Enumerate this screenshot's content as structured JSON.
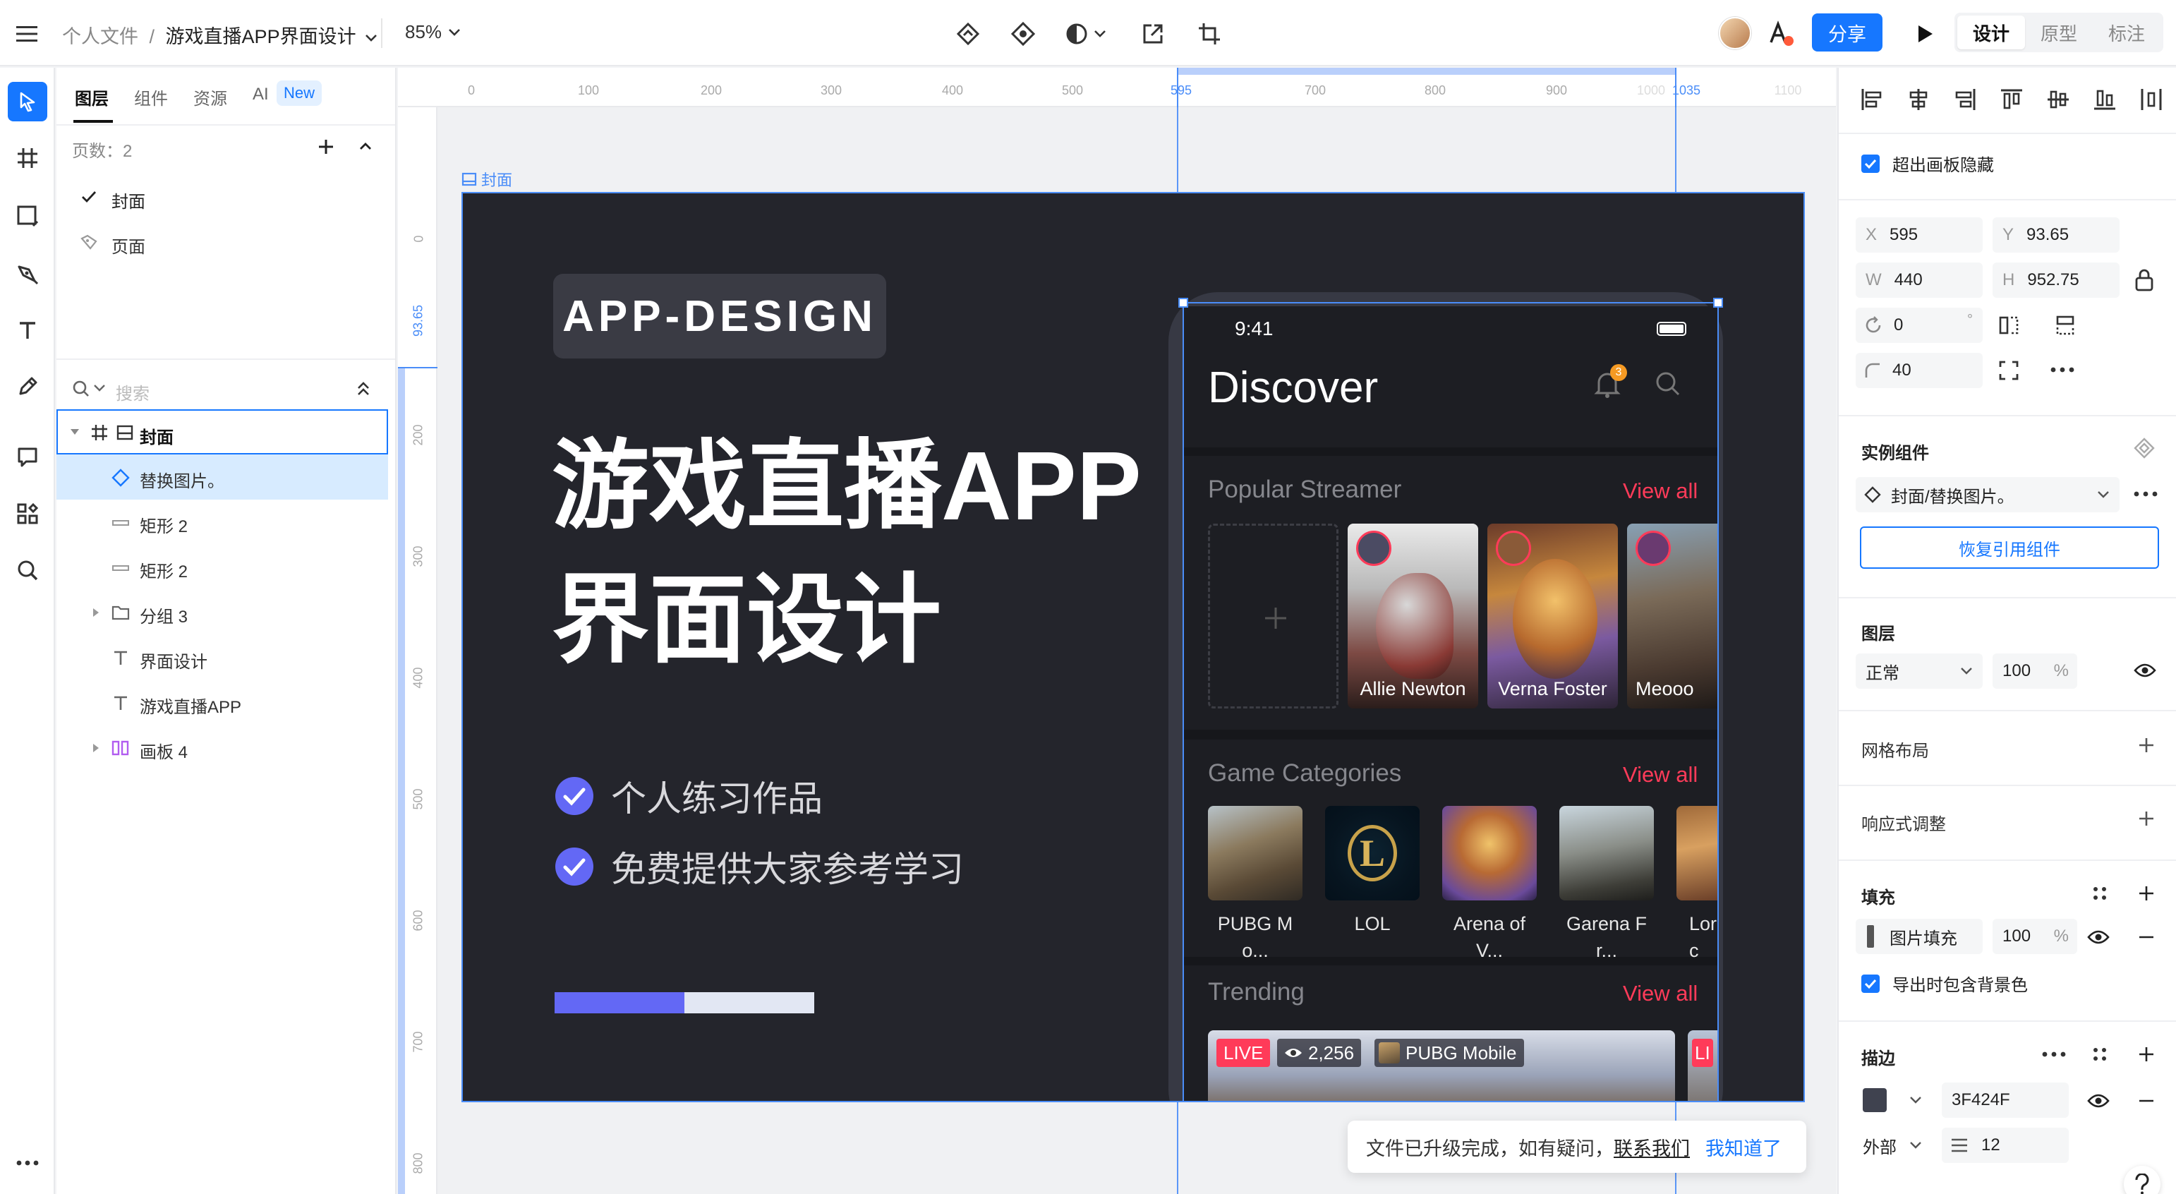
{
  "topbar": {
    "breadcrumb_root": "个人文件",
    "breadcrumb_sep": "/",
    "file_name": "游戏直播APP界面设计",
    "zoom": "85%",
    "share_label": "分享",
    "modes": [
      "设计",
      "原型",
      "标注"
    ]
  },
  "layer_panel": {
    "tabs": [
      "图层",
      "组件",
      "资源",
      "AI"
    ],
    "ai_badge": "New",
    "pages_label": "页数：2",
    "pages": [
      "封面",
      "页面"
    ],
    "search_placeholder": "搜索",
    "layers": [
      {
        "label": "封面",
        "type": "frame"
      },
      {
        "label": "替换图片。",
        "type": "component"
      },
      {
        "label": "矩形 2",
        "type": "rect"
      },
      {
        "label": "矩形 2",
        "type": "rect"
      },
      {
        "label": "分组 3",
        "type": "group"
      },
      {
        "label": "界面设计",
        "type": "text"
      },
      {
        "label": "游戏直播APP",
        "type": "text"
      },
      {
        "label": "画板 4",
        "type": "board"
      }
    ]
  },
  "ruler": {
    "top": [
      "0",
      "100",
      "200",
      "300",
      "400",
      "500",
      "595",
      "700",
      "800",
      "900",
      "1000",
      "1035",
      "1100"
    ],
    "left": [
      "0",
      "93.65",
      "200",
      "300",
      "400",
      "500",
      "600",
      "700",
      "800"
    ]
  },
  "artboard": {
    "label": "封面",
    "badge": "APP-DESIGN",
    "title_line1": "游戏直播APP",
    "title_line2": "界面设计",
    "bullets": [
      "个人练习作品",
      "免费提供大家参考学习"
    ],
    "progress_fraction": 0.5
  },
  "phone": {
    "time": "9:41",
    "title": "Discover",
    "notif_count": "3",
    "sections": {
      "popular": {
        "title": "Popular Streamer",
        "view_all": "View all"
      },
      "categories": {
        "title": "Game Categories",
        "view_all": "View all"
      },
      "trending": {
        "title": "Trending",
        "view_all": "View all"
      }
    },
    "streamers": [
      "Allie Newton",
      "Verna Foster",
      "Meooo"
    ],
    "games": [
      {
        "name_l1": "PUBG M",
        "name_l2": "o..."
      },
      {
        "name_l1": "LOL",
        "name_l2": ""
      },
      {
        "name_l1": "Arena of",
        "name_l2": "V..."
      },
      {
        "name_l1": "Garena F",
        "name_l2": "r..."
      },
      {
        "name_l1": "Lor",
        "name_l2": "c"
      }
    ],
    "trending": {
      "live": "LIVE",
      "viewers": "2,256",
      "game": "PUBG Mobile",
      "live2": "LI"
    }
  },
  "right_panel": {
    "clip_label": "超出画板隐藏",
    "x": "595",
    "y": "93.65",
    "w": "440",
    "h": "952.75",
    "rotation": "0",
    "radius": "40",
    "k_x": "X",
    "k_y": "Y",
    "k_w": "W",
    "k_h": "H",
    "deg": "°",
    "instance_title": "实例组件",
    "instance_name": "封面/替换图片。",
    "restore_button": "恢复引用组件",
    "layer_title": "图层",
    "blend_mode": "正常",
    "opacity": "100",
    "percent": "%",
    "grid_title": "网格布局",
    "responsive_title": "响应式调整",
    "fill_title": "填充",
    "fill_type": "图片填充",
    "fill_opacity": "100",
    "export_bg_label": "导出时包含背景色",
    "stroke_title": "描边",
    "stroke_color": "3F424F",
    "stroke_position": "外部",
    "stroke_width": "12"
  },
  "toast": {
    "message": "文件已升级完成，如有疑问，",
    "contact_link": "联系我们",
    "ack_button": "我知道了"
  },
  "colors": {
    "accent": "#1677ff",
    "artboard_bg": "#24252c",
    "brand_purple": "#6368f5",
    "live_red": "#ff3b59"
  }
}
